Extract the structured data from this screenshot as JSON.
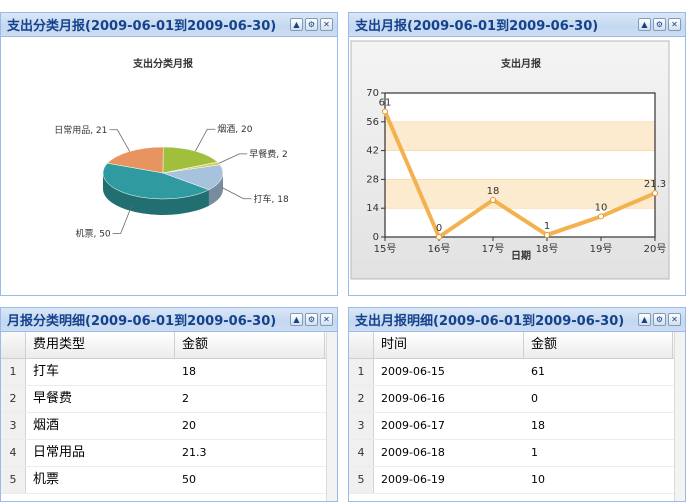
{
  "panels": {
    "category_chart": {
      "title": "支出分类月报(2009-06-01到2009-06-30)",
      "chart_title": "支出分类月报"
    },
    "monthly_chart": {
      "title": "支出月报(2009-06-01到2009-06-30)",
      "chart_title": "支出月报",
      "x_axis_label": "日期"
    },
    "category_detail": {
      "title": "月报分类明细(2009-06-01到2009-06-30)",
      "columns": [
        "费用类型",
        "金额"
      ],
      "rows": [
        [
          "1",
          "打车",
          "18"
        ],
        [
          "2",
          "早餐费",
          "2"
        ],
        [
          "3",
          "烟酒",
          "20"
        ],
        [
          "4",
          "日常用品",
          "21.3"
        ],
        [
          "5",
          "机票",
          "50"
        ]
      ]
    },
    "monthly_detail": {
      "title": "支出月报明细(2009-06-01到2009-06-30)",
      "columns": [
        "时间",
        "金额"
      ],
      "rows": [
        [
          "1",
          "2009-06-15",
          "61"
        ],
        [
          "2",
          "2009-06-16",
          "0"
        ],
        [
          "3",
          "2009-06-17",
          "18"
        ],
        [
          "4",
          "2009-06-18",
          "1"
        ],
        [
          "5",
          "2009-06-19",
          "10"
        ]
      ]
    }
  },
  "tool_icons": [
    "collapse-icon",
    "gear-icon",
    "close-icon"
  ],
  "chart_data": [
    {
      "type": "pie",
      "title": "支出分类月报",
      "labels": [
        "机票",
        "日常用品",
        "烟酒",
        "早餐费",
        "打车"
      ],
      "values": [
        50,
        21,
        20,
        2,
        18
      ],
      "colors": [
        "#2f9a9f",
        "#e89460",
        "#a0bf3c",
        "#d8cf5c",
        "#a6c2dd"
      ]
    },
    {
      "type": "line",
      "title": "支出月报",
      "xlabel": "日期",
      "categories": [
        "15号",
        "16号",
        "17号",
        "18号",
        "19号",
        "20号"
      ],
      "values": [
        61,
        0,
        18,
        1,
        10,
        21.3
      ],
      "ylim": [
        0,
        70
      ],
      "yticks": [
        0,
        14,
        28,
        42,
        56,
        70
      ],
      "color": "#f3b24f"
    }
  ]
}
